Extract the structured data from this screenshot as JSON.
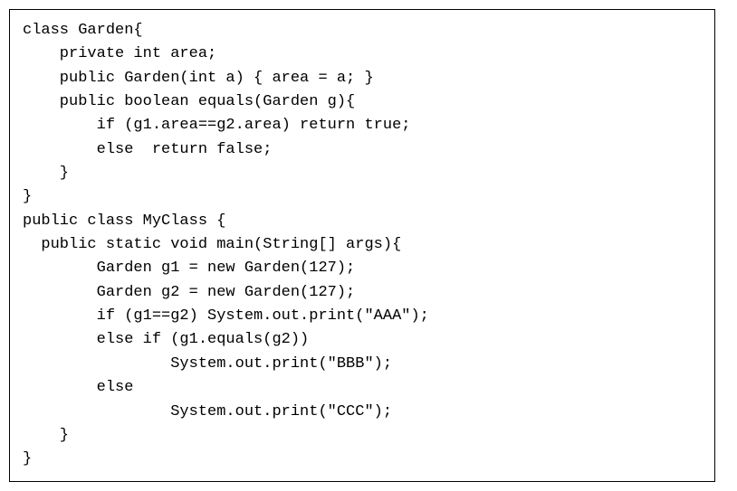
{
  "code": {
    "lines": [
      "class Garden{",
      "    private int area;",
      "    public Garden(int a) { area = a; }",
      "    public boolean equals(Garden g){",
      "        if (g1.area==g2.area) return true;",
      "        else  return false;",
      "    }",
      "}",
      "public class MyClass {",
      "  public static void main(String[] args){",
      "        Garden g1 = new Garden(127);",
      "        Garden g2 = new Garden(127);",
      "        if (g1==g2) System.out.print(\"AAA\");",
      "        else if (g1.equals(g2))",
      "                System.out.print(\"BBB\");",
      "        else",
      "                System.out.print(\"CCC\");",
      "    }",
      "}"
    ]
  }
}
